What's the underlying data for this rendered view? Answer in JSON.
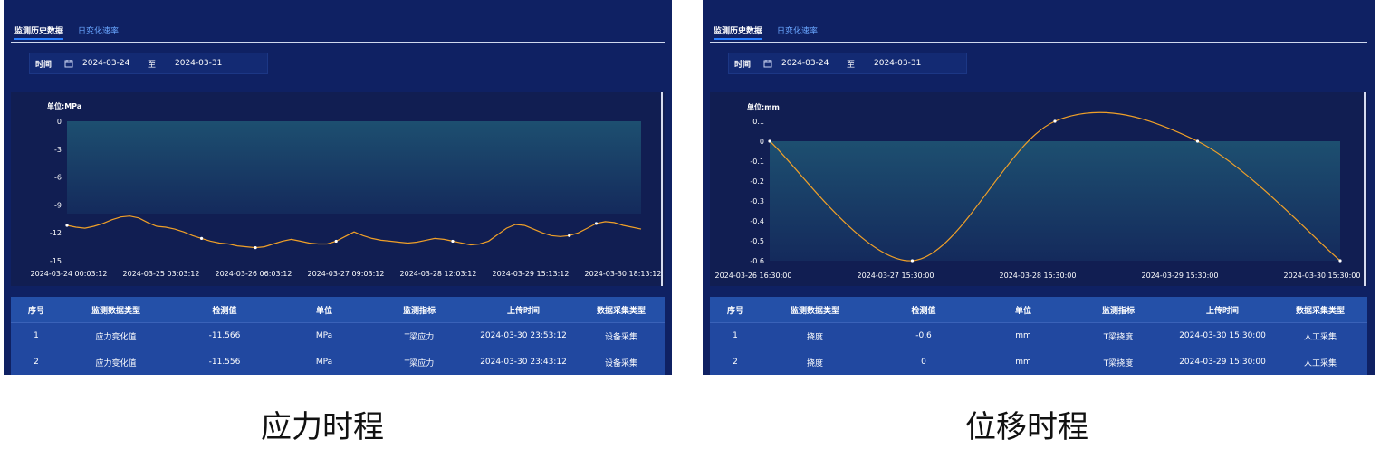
{
  "panels": [
    {
      "tabs": [
        "监测历史数据",
        "日变化速率"
      ],
      "filter": {
        "label": "时间",
        "start": "2024-03-24",
        "sep": "至",
        "end": "2024-03-31"
      },
      "chart": {
        "unit": "单位:MPa"
      },
      "table": {
        "headers": [
          "序号",
          "监测数据类型",
          "检测值",
          "单位",
          "监测指标",
          "上传时间",
          "数据采集类型"
        ],
        "rows": [
          [
            "1",
            "应力变化值",
            "-11.566",
            "MPa",
            "T梁应力",
            "2024-03-30 23:53:12",
            "设备采集"
          ],
          [
            "2",
            "应力变化值",
            "-11.556",
            "MPa",
            "T梁应力",
            "2024-03-30 23:43:12",
            "设备采集"
          ]
        ]
      },
      "caption": "应力时程"
    },
    {
      "tabs": [
        "监测历史数据",
        "日变化速率"
      ],
      "filter": {
        "label": "时间",
        "start": "2024-03-24",
        "sep": "至",
        "end": "2024-03-31"
      },
      "chart": {
        "unit": "单位:mm"
      },
      "table": {
        "headers": [
          "序号",
          "监测数据类型",
          "检测值",
          "单位",
          "监测指标",
          "上传时间",
          "数据采集类型"
        ],
        "rows": [
          [
            "1",
            "挠度",
            "-0.6",
            "mm",
            "T梁挠度",
            "2024-03-30 15:30:00",
            "人工采集"
          ],
          [
            "2",
            "挠度",
            "0",
            "mm",
            "T梁挠度",
            "2024-03-29 15:30:00",
            "人工采集"
          ]
        ]
      },
      "caption": "位移时程"
    }
  ],
  "chart_data": [
    {
      "type": "area",
      "ylabel": "单位:MPa",
      "ylim": [
        -15,
        0
      ],
      "yticks": [
        "0",
        "-3",
        "-6",
        "-9",
        "-12",
        "-15"
      ],
      "xticks": [
        "2024-03-24 00:03:12",
        "2024-03-25 03:03:12",
        "2024-03-26 06:03:12",
        "2024-03-27 09:03:12",
        "2024-03-28 12:03:12",
        "2024-03-29 15:13:12",
        "2024-03-30 18:13:12"
      ],
      "series": [
        {
          "values": [
            -11.2,
            -11.4,
            -11.5,
            -11.3,
            -11.0,
            -10.6,
            -10.3,
            -10.2,
            -10.4,
            -10.9,
            -11.3,
            -11.4,
            -11.6,
            -11.9,
            -12.3,
            -12.6,
            -12.9,
            -13.1,
            -13.2,
            -13.4,
            -13.5,
            -13.6,
            -13.5,
            -13.2,
            -12.9,
            -12.7,
            -12.9,
            -13.1,
            -13.2,
            -13.2,
            -12.9,
            -12.4,
            -11.9,
            -12.3,
            -12.6,
            -12.8,
            -12.9,
            -13.0,
            -13.1,
            -13.0,
            -12.8,
            -12.6,
            -12.7,
            -12.9,
            -13.1,
            -13.3,
            -13.2,
            -12.9,
            -12.2,
            -11.5,
            -11.1,
            -11.2,
            -11.6,
            -12.0,
            -12.3,
            -12.4,
            -12.3,
            -12.0,
            -11.5,
            -11.0,
            -10.8,
            -10.9,
            -11.2,
            -11.4,
            -11.6
          ]
        }
      ],
      "line_color": "#f0a028",
      "grid": false
    },
    {
      "type": "area",
      "ylabel": "单位:mm",
      "ylim": [
        -0.6,
        0.1
      ],
      "yticks": [
        "0.1",
        "0",
        "-0.1",
        "-0.2",
        "-0.3",
        "-0.4",
        "-0.5",
        "-0.6"
      ],
      "xticks": [
        "2024-03-26 16:30:00",
        "2024-03-27 15:30:00",
        "2024-03-28 15:30:00",
        "2024-03-29 15:30:00",
        "2024-03-30 15:30:00"
      ],
      "x": [
        "2024-03-26 16:30:00",
        "2024-03-27 15:30:00",
        "2024-03-28 09:30:00",
        "2024-03-29 15:30:00",
        "2024-03-30 15:30:00"
      ],
      "series": [
        {
          "values": [
            0,
            -0.6,
            0.1,
            0,
            -0.6
          ]
        }
      ],
      "line_color": "#f0a028",
      "grid": false
    }
  ]
}
